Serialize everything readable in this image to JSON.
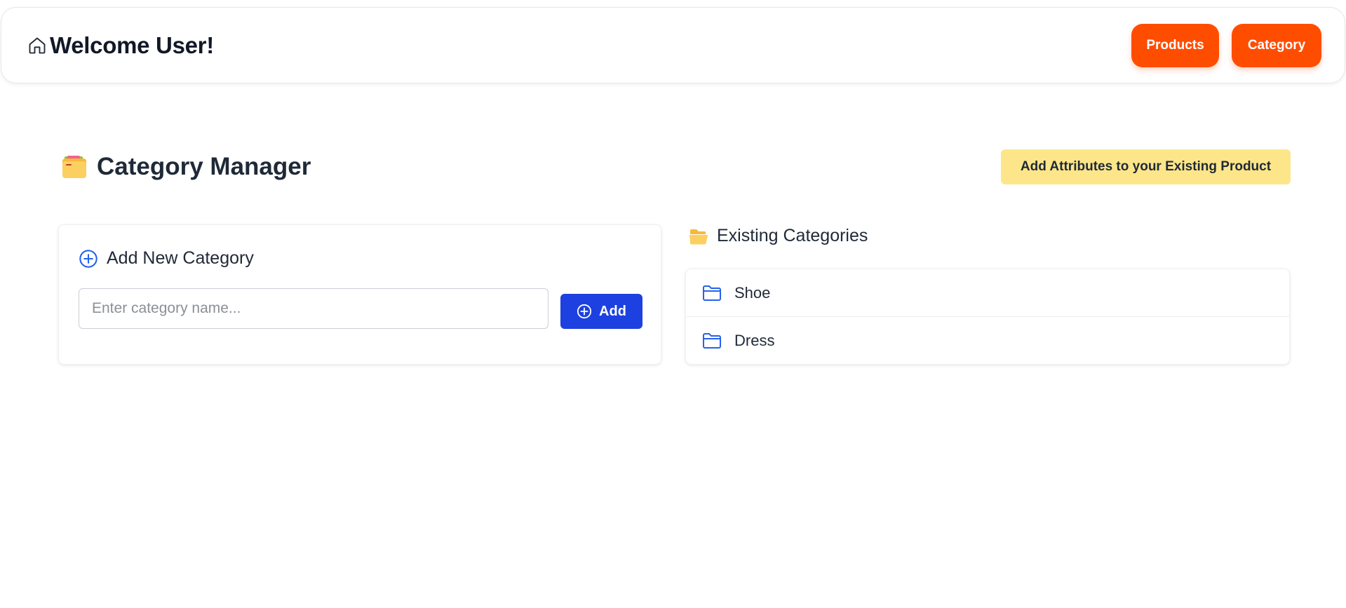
{
  "header": {
    "title": "Welcome User!",
    "home_icon": "home-icon",
    "nav": [
      {
        "label": "Products"
      },
      {
        "label": "Category"
      }
    ]
  },
  "page": {
    "title": "Category Manager",
    "title_icon": "card-index-folder-icon",
    "attributes_button": "Add Attributes to your Existing Product"
  },
  "add_category": {
    "title": "Add New Category",
    "icon": "plus-circle-icon",
    "input": {
      "value": "",
      "placeholder": "Enter category name..."
    },
    "button_label": "Add"
  },
  "existing": {
    "title": "Existing Categories",
    "icon": "open-folder-icon",
    "items": [
      {
        "label": "Shoe",
        "icon": "folder-icon"
      },
      {
        "label": "Dress",
        "icon": "folder-icon"
      }
    ]
  },
  "colors": {
    "nav_button": "#ff4d00",
    "attributes_button": "#fde68a",
    "add_button": "#1d40e0",
    "icon_blue": "#2563eb",
    "text": "#1f2937"
  }
}
